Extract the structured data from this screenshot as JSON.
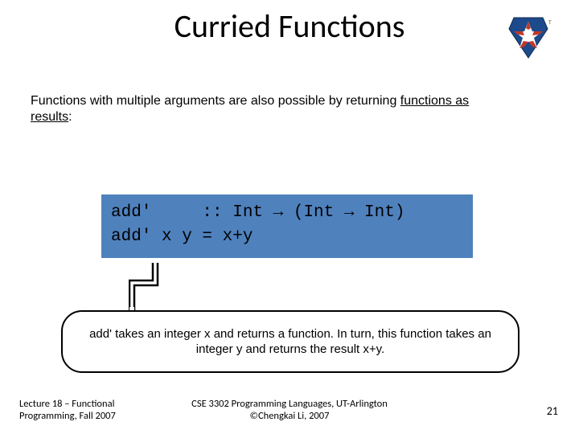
{
  "title": "Curried Functions",
  "logo": {
    "name": "uta-star-logo"
  },
  "intro": {
    "pre": "Functions with multiple arguments are also possible by returning ",
    "ul1": "functions as",
    "ul2": "results",
    "post": ":"
  },
  "code": {
    "line1": "add'     :: Int → (Int → Int)",
    "line2": "add' x y = x+y"
  },
  "callout": "add' takes an integer x and returns a function.  In turn, this function takes an integer y and returns the result x+y.",
  "footer": {
    "left_line1": "Lecture 18 – Functional",
    "left_line2": "Programming, Fall 2007",
    "center_line1": "CSE 3302 Programming Languages, UT-Arlington",
    "center_line2": "©Chengkai Li, 2007",
    "pagenum": "21"
  }
}
